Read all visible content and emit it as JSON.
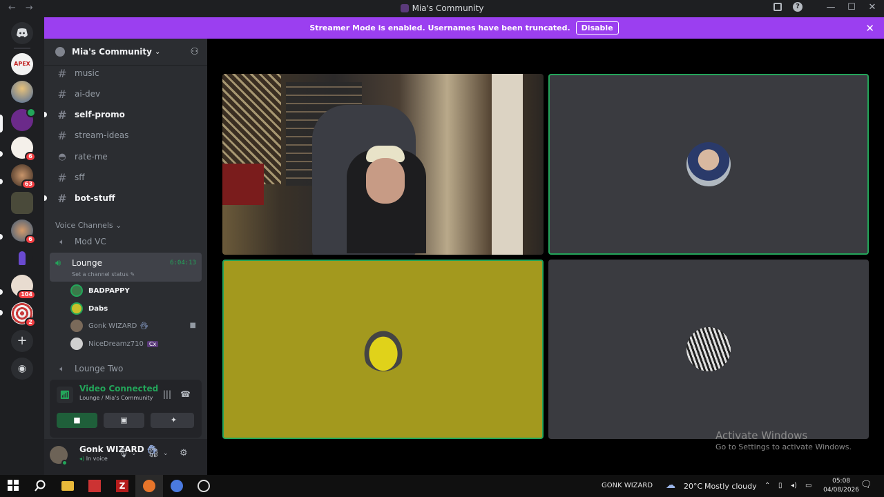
{
  "window": {
    "title": "Mia's Community",
    "back": "←",
    "forward": "→",
    "help": "?",
    "minimize": "—",
    "maximize": "☐",
    "close": "✕"
  },
  "banner": {
    "text": "Streamer Mode is enabled. Usernames have been truncated.",
    "button": "Disable",
    "close": "✕"
  },
  "servers": [
    {
      "name": "discord-home",
      "color": "#2b2d31"
    },
    {
      "name": "apex",
      "color": "#f2f2f2",
      "label": "APEX"
    },
    {
      "name": "server-2",
      "color": "#c9a05a"
    },
    {
      "name": "server-3",
      "color": "#6b2a8a"
    },
    {
      "name": "server-4",
      "color": "#f4f0ea",
      "badge": "6"
    },
    {
      "name": "server-5",
      "color": "#8a5a3c",
      "badge": "63"
    },
    {
      "name": "server-6",
      "color": "#4a4a3a"
    },
    {
      "name": "server-7",
      "color": "#9a7a5a",
      "badge": "6"
    },
    {
      "name": "server-8",
      "color": "#2c2d7a"
    },
    {
      "name": "server-9",
      "color": "#e8dcd0",
      "badge": "104"
    },
    {
      "name": "server-10",
      "color": "#c83a3a",
      "badge": "2"
    }
  ],
  "sidebar": {
    "guild_name": "Mia's Community",
    "channels": [
      {
        "name": "music",
        "unread": false
      },
      {
        "name": "ai-dev",
        "unread": false
      },
      {
        "name": "self-promo",
        "unread": true
      },
      {
        "name": "stream-ideas",
        "unread": false
      },
      {
        "name": "rate-me",
        "unread": false
      },
      {
        "name": "sff",
        "unread": false
      },
      {
        "name": "bot-stuff",
        "unread": true
      }
    ],
    "voice_category": "Voice Channels",
    "voice_channels": {
      "mod_vc": "Mod VC",
      "lounge": "Lounge",
      "lounge_timer": "6:04:13",
      "lounge_status": "Set a channel status",
      "lounge_two": "Lounge Two"
    },
    "members": [
      {
        "name": "BADPAPPY",
        "color": "#3a7a4a"
      },
      {
        "name": "Dabs",
        "color": "#c7c02a"
      },
      {
        "name": "Gonk WIZARD",
        "color": "#7a6a5a"
      },
      {
        "name": "NiceDreamz710",
        "color": "#d0d0d0",
        "tag": "Cx"
      }
    ]
  },
  "voice_panel": {
    "title": "Video Connected",
    "subtitle": "Lounge / Mia's Community"
  },
  "user": {
    "name": "Gonk WIZARD",
    "status": "In voice"
  },
  "watermark": {
    "line1": "Activate Windows",
    "line2": "Go to Settings to activate Windows."
  },
  "taskbar": {
    "user": "GONK WIZARD",
    "weather": "20°C",
    "weather_desc": "Mostly cloudy",
    "time": "05:08",
    "date": "04/08/2026"
  },
  "colors": {
    "accent": "#9b3ff0",
    "speaking": "#23a55a",
    "tile_gray": "#3a3b40",
    "tile_yellow": "#a3991e"
  }
}
